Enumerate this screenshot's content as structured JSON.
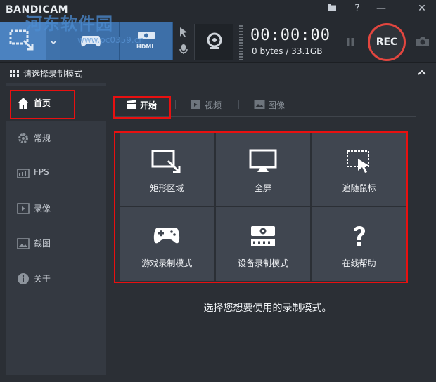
{
  "app": {
    "brand": "BANDICAM"
  },
  "watermark": {
    "text": "河东软件园",
    "url": "www.pc0359.cn"
  },
  "toolbar": {
    "timer": "00:00:00",
    "size": "0 bytes / 33.1GB",
    "rec_label": "REC",
    "hdmi_label": "HDMI"
  },
  "header": {
    "title": "请选择录制模式"
  },
  "sidebar": {
    "items": [
      {
        "label": "首页",
        "icon": "home-icon",
        "active": true
      },
      {
        "label": "常规",
        "icon": "gear-icon"
      },
      {
        "label": "FPS",
        "icon": "fps-icon"
      },
      {
        "label": "录像",
        "icon": "video-icon"
      },
      {
        "label": "截图",
        "icon": "image-icon"
      },
      {
        "label": "关于",
        "icon": "info-icon"
      }
    ]
  },
  "tabs": [
    {
      "label": "开始",
      "icon": "clapper-icon",
      "active": true
    },
    {
      "label": "视频",
      "icon": "play-icon"
    },
    {
      "label": "图像",
      "icon": "picture-icon"
    }
  ],
  "modes": [
    {
      "label": "矩形区域",
      "icon": "rectangle-area-icon"
    },
    {
      "label": "全屏",
      "icon": "monitor-icon"
    },
    {
      "label": "追随鼠标",
      "icon": "mouse-follow-icon"
    },
    {
      "label": "游戏录制模式",
      "icon": "gamepad-icon"
    },
    {
      "label": "设备录制模式",
      "icon": "hdmi-device-icon"
    },
    {
      "label": "在线帮助",
      "icon": "help-icon"
    }
  ],
  "hint": "选择您想要使用的录制模式。",
  "colors": {
    "accent": "#3d6fa8",
    "rec_ring": "#e2463f",
    "highlight": "#e81010"
  }
}
